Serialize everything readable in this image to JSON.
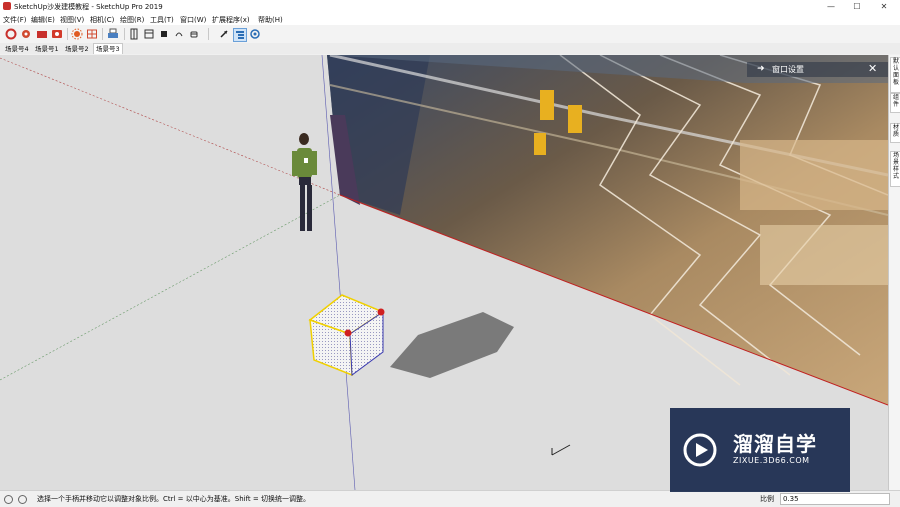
{
  "window": {
    "title": "SketchUp沙发建模教程 - SketchUp Pro 2019",
    "minimize": "—",
    "maximize": "☐",
    "close": "✕"
  },
  "menu": [
    "文件(F)",
    "编辑(E)",
    "视图(V)",
    "相机(C)",
    "绘图(R)",
    "工具(T)",
    "窗口(W)",
    "扩展程序(x)",
    "帮助(H)"
  ],
  "toolbar": {
    "icons": [
      "open-icon",
      "gear-icon",
      "folder-icon",
      "camera-icon",
      "sun-icon",
      "grid-icon",
      "print-icon",
      "door-icon",
      "window-icon",
      "rect-icon",
      "arc-icon",
      "roll-icon",
      "move-icon",
      "outliner-icon",
      "settings-icon"
    ]
  },
  "scenes": [
    "场景号4",
    "场景号1",
    "场景号2",
    "场景号3"
  ],
  "active_scene": "场景号3",
  "panel": {
    "title": "窗口设置",
    "arrow": "➜",
    "close": "✕"
  },
  "right_tabs": [
    "默认面板",
    "组件",
    "材质",
    "场景样式"
  ],
  "status": {
    "hint": "选择一个手柄并移动它以调整对象比例。Ctrl = 以中心为基准。Shift = 切换统一调整。",
    "measure_label": "比例",
    "measure_value": "0.35"
  },
  "watermark": {
    "brand": "溜溜自学",
    "url": "ZIXUE.3D66.COM"
  },
  "colors": {
    "accent": "#c8302c",
    "viewport_bg": "#dddddd",
    "watermark_bg": "#00123a",
    "selection_yellow": "#f0d000"
  }
}
